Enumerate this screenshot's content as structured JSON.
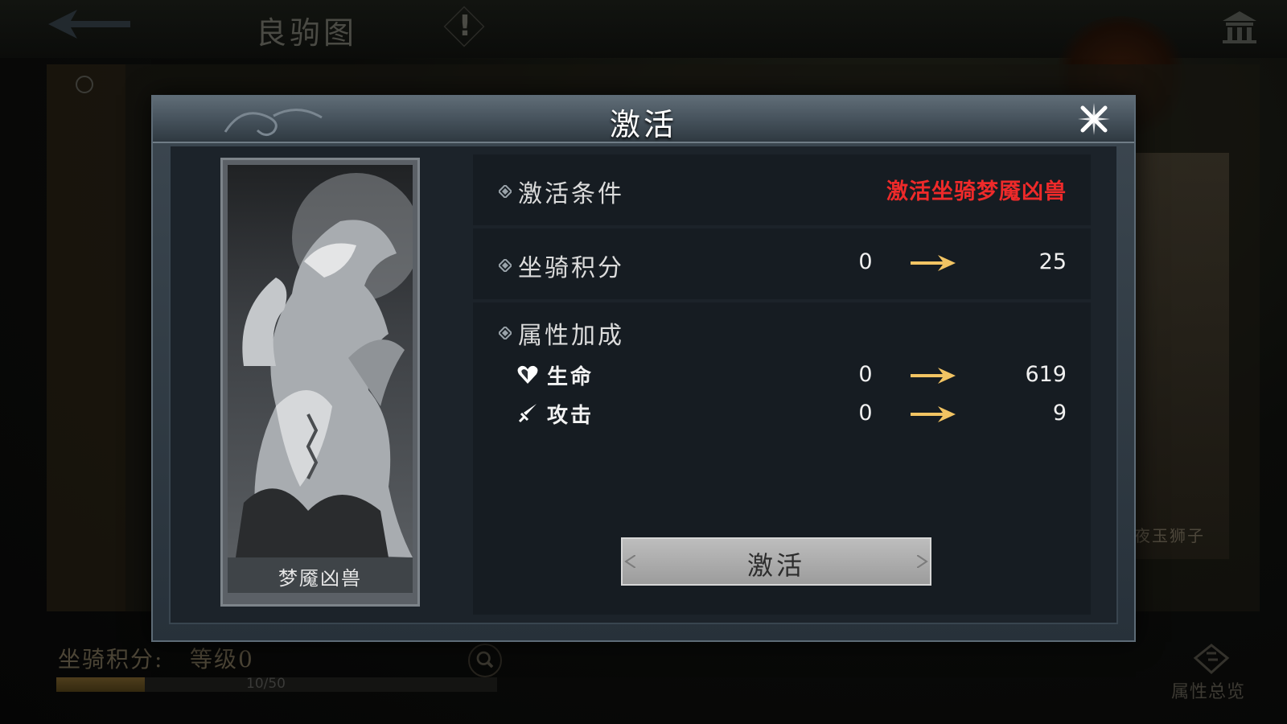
{
  "background": {
    "title": "良驹图",
    "info_mark": "!",
    "right_card_name": "夜玉狮子",
    "score_label": "坐骑积分:",
    "level_label": "等级0",
    "progress": {
      "current": 10,
      "max": 50,
      "text": "10/50"
    },
    "attr_overview_label": "属性总览"
  },
  "modal": {
    "title": "激活",
    "portrait": {
      "name": "梦魇凶兽"
    },
    "condition": {
      "label": "激活条件",
      "value": "激活坐骑梦魇凶兽",
      "value_color": "#ee2a2a"
    },
    "mount_score": {
      "label": "坐骑积分",
      "from": "0",
      "to": "25"
    },
    "attributes": {
      "label": "属性加成",
      "items": [
        {
          "icon": "heart-icon",
          "name": "生命",
          "from": "0",
          "to": "619"
        },
        {
          "icon": "sword-icon",
          "name": "攻击",
          "from": "0",
          "to": "9"
        }
      ]
    },
    "activate_button": "激活"
  }
}
